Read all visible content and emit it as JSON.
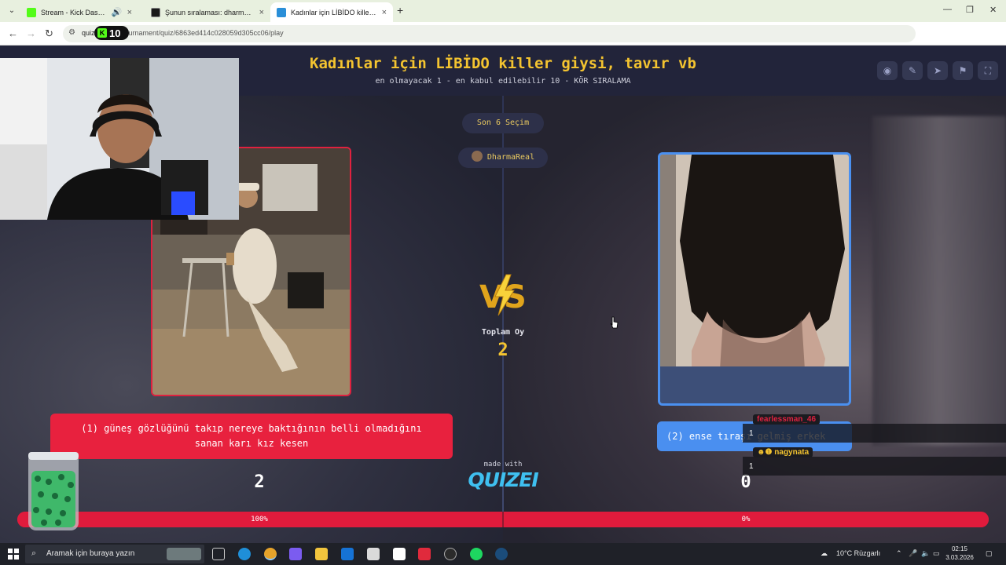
{
  "browser": {
    "tabs": [
      {
        "title": "Stream - Kick Dashboard",
        "favicon_color": "#53fc18"
      },
      {
        "title": "Şunun sıralaması: dharmareal |",
        "favicon_color": "#1a1a1a"
      },
      {
        "title": "Kadınlar için LİBİDO killer giysi,",
        "favicon_color": "#2a8fd8"
      }
    ],
    "url_host": "quiz",
    "url_path": "ournament/quiz/6863ed414c028059d305cc06/play",
    "kick_badge_count": "10"
  },
  "quiz": {
    "title": "Kadınlar için LİBİDO killer giysi, tavır vb",
    "subtitle": "en olmayacak 1 - en kabul edilebilir 10 - KÖR SIRALAMA",
    "last_selection": "Son 6 Seçim",
    "streamer": "DharmaReal",
    "total_label": "Toplam Oy",
    "total_value": "2",
    "left": {
      "label": "(1) güneş gözlüğünü takıp nereye baktığının belli olmadığını sanan karı kız kesen",
      "score": "2",
      "percent": "100%"
    },
    "right": {
      "label": "(2) ense tıraşı gelmiş erkek",
      "score": "0",
      "percent": "0%"
    },
    "made_with": "made with",
    "brand": "QUIZEI",
    "progress_fraction": 1.0
  },
  "chat": [
    {
      "user": "fearlessman_46",
      "count": "1",
      "color": "#e0213f"
    },
    {
      "user": "nagynata",
      "count": "1",
      "color": "#f4c430"
    }
  ],
  "chat_overlay_text": "ense tra",
  "chat_overlay_text2": "ı gelmiş erkek",
  "taskbar": {
    "search_placeholder": "Aramak için buraya yazın",
    "weather": "10°C  Rüzgarlı",
    "time": "02:15",
    "date": "3.03.2026"
  },
  "colors": {
    "accent_gold": "#f4c430",
    "left_red": "#e8213e",
    "right_blue": "#4a8ff0"
  }
}
